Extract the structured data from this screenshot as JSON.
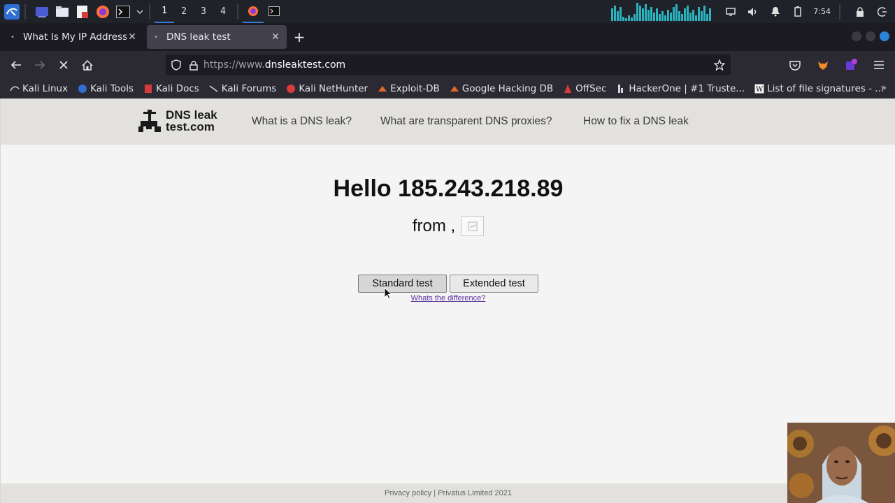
{
  "taskbar": {
    "workspaces": [
      "1",
      "2",
      "3",
      "4"
    ],
    "clock": "7:54",
    "icons": [
      "kali-menu-icon",
      "desktop-icon",
      "file-manager-icon",
      "text-editor-icon",
      "firefox-icon",
      "terminal-icon"
    ]
  },
  "browser": {
    "tabs": [
      {
        "title": "What Is My IP Address - S",
        "selected": false
      },
      {
        "title": "DNS leak test",
        "selected": true
      }
    ],
    "new_tab": "+",
    "url_prefix": "https://www.",
    "url_domain": "dnsleaktest.com",
    "bookmarks": [
      "Kali Linux",
      "Kali Tools",
      "Kali Docs",
      "Kali Forums",
      "Kali NetHunter",
      "Exploit-DB",
      "Google Hacking DB",
      "OffSec",
      "HackerOne | #1 Truste...",
      "List of file signatures - ..."
    ],
    "bookmarks_more": "»"
  },
  "site": {
    "logo_line1": "DNS leak",
    "logo_line2": "test.com",
    "nav": [
      "What is a DNS leak?",
      "What are transparent DNS proxies?",
      "How to fix a DNS leak"
    ],
    "hello": "Hello 185.243.218.89",
    "from": "from ,",
    "standard_test": "Standard test",
    "extended_test": "Extended test",
    "difference_link": "Whats the difference?",
    "footer": "Privacy policy | Privatus Limited 2021"
  },
  "colors": {
    "taskbar_bg": "#1f2228",
    "browser_bg": "#2b2a33",
    "page_bg": "#f4f4f4",
    "header_bg": "#e2e1de",
    "accent": "#3a7bd5"
  }
}
